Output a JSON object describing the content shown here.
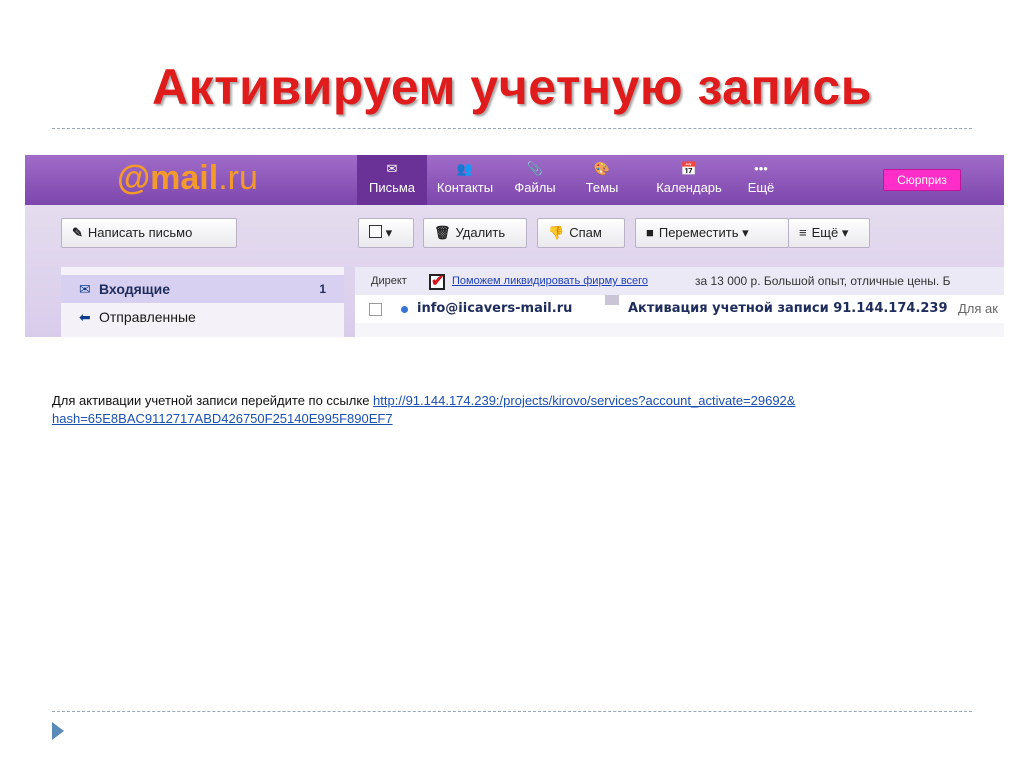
{
  "slide": {
    "title": "Активируем учетную запись"
  },
  "mail": {
    "logo_at": "@",
    "logo_mail": "mail",
    "logo_ru": ".ru",
    "nav": [
      {
        "icon": "✉",
        "label": "Письма"
      },
      {
        "icon": "👥",
        "label": "Контакты"
      },
      {
        "icon": "📎",
        "label": "Файлы"
      },
      {
        "icon": "🎨",
        "label": "Темы"
      },
      {
        "icon": "📅",
        "label": "Календарь"
      },
      {
        "icon": "•••",
        "label": "Ещё"
      }
    ],
    "surprise_label": "Сюрприз",
    "compose_label": "Написать письмо",
    "toolbar": {
      "delete_label": "Удалить",
      "spam_label": "Спам",
      "move_label": "Переместить",
      "more_label": "Ещё"
    },
    "folders": [
      {
        "name": "Входящие",
        "count": "1"
      },
      {
        "name": "Отправленные",
        "count": ""
      }
    ],
    "direct": {
      "label": "Директ",
      "link_text": "Поможем ликвидировать фирму всего",
      "text": "за 13 000 р. Большой опыт, отличные цены. Б"
    },
    "message": {
      "from": "info@iicavers-mail.ru",
      "subject": "Активация учетной записи 91.144.174.239",
      "snippet": "Для ак"
    }
  },
  "email_body": {
    "prefix": "Для активации учетной записи перейдите по ссылке ",
    "link_line1": "http://91.144.174.239:/projects/kirovo/services?account_activate=29692&",
    "link_line2": "hash=65E8BAC9112717ABD426750F25140E995F890EF7"
  },
  "colors": {
    "title_red": "#e01b1b",
    "header_purple": "#7d46ad",
    "logo_orange": "#f39a2b",
    "surprise_pink": "#ff2ec8",
    "link_blue": "#1a4fb3"
  }
}
